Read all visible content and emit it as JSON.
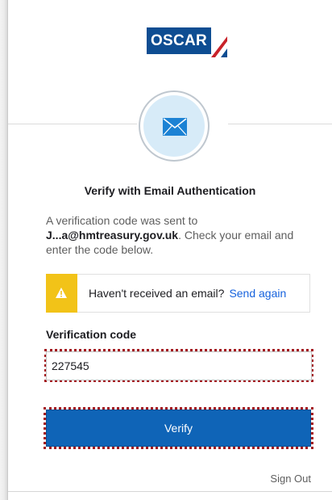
{
  "logo": {
    "text": "OSCAR",
    "icon": "oscar-logo"
  },
  "header": {
    "icon": "envelope-icon"
  },
  "title": "Verify with Email Authentication",
  "message": {
    "prefix": "A verification code was sent to",
    "email": "J...a@hmtreasury.gov.uk",
    "suffix": ". Check your email and enter the code below."
  },
  "notice": {
    "icon": "warning-icon",
    "text": "Haven't received an email?",
    "link_label": "Send again"
  },
  "form": {
    "label": "Verification code",
    "value": "227545"
  },
  "actions": {
    "verify_label": "Verify",
    "sign_out_label": "Sign Out"
  },
  "colors": {
    "primary": "#0f64b7",
    "logo_blue": "#0e4d92",
    "logo_red": "#c8222a",
    "warning": "#f2c318",
    "link": "#1662dd",
    "highlight": "#a3161d"
  }
}
